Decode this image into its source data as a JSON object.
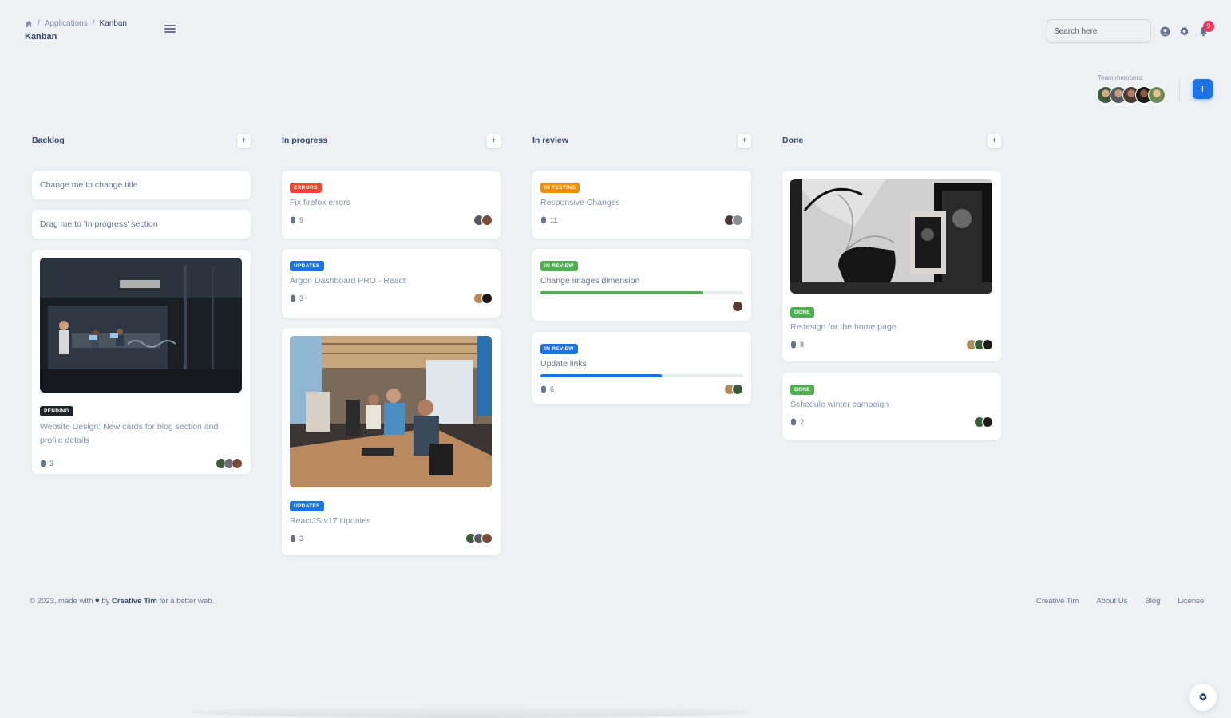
{
  "breadcrumb": {
    "section": "Applications",
    "current": "Kanban",
    "separator": "/"
  },
  "page": {
    "title": "Kanban"
  },
  "search": {
    "placeholder": "Search here"
  },
  "notifications": {
    "count": "9"
  },
  "team": {
    "label": "Team members:",
    "add_label": "+"
  },
  "columns": [
    {
      "title": "Backlog",
      "add": "+"
    },
    {
      "title": "In progress",
      "add": "+"
    },
    {
      "title": "In review",
      "add": "+"
    },
    {
      "title": "Done",
      "add": "+"
    }
  ],
  "backlog": {
    "card1": {
      "text": "Change me to change title"
    },
    "card2": {
      "text": "Drag me to 'In progress' section"
    },
    "card3": {
      "badge": "PENDING",
      "text": "Website Design: New cards for blog section and profile details",
      "attachments": "3"
    }
  },
  "in_progress": {
    "card1": {
      "badge": "ERRORS",
      "text": "Fix firefox errors",
      "attachments": "9"
    },
    "card2": {
      "badge": "UPDATES",
      "text": "Argon Dashboard PRO - React",
      "attachments": "3"
    },
    "card3": {
      "badge": "UPDATES",
      "text": "ReactJS v17 Updates",
      "attachments": "3"
    }
  },
  "in_review": {
    "card1": {
      "badge": "IN TESTING",
      "text": "Responsive Changes",
      "attachments": "11"
    },
    "card2": {
      "badge": "IN REVIEW",
      "text": "Change images dimension",
      "progress": 0.8
    },
    "card3": {
      "badge": "IN REVIEW",
      "text": "Update links",
      "progress": 0.6,
      "attachments": "6"
    }
  },
  "done": {
    "card1": {
      "badge": "DONE",
      "text": "Redesign for the home page",
      "attachments": "8"
    },
    "card2": {
      "badge": "DONE",
      "text": "Schedule winter campaign",
      "attachments": "2"
    }
  },
  "footer": {
    "copyright": "© 2023, made with",
    "by": "by",
    "author": "Creative Tim",
    "suffix": "for a better web.",
    "links": [
      "Creative Tim",
      "About Us",
      "Blog",
      "License"
    ]
  },
  "colors": {
    "primary": "#1a73e8",
    "success": "#4caf50",
    "danger": "#f44335",
    "warning": "#fb8c00",
    "dark": "#212529"
  }
}
